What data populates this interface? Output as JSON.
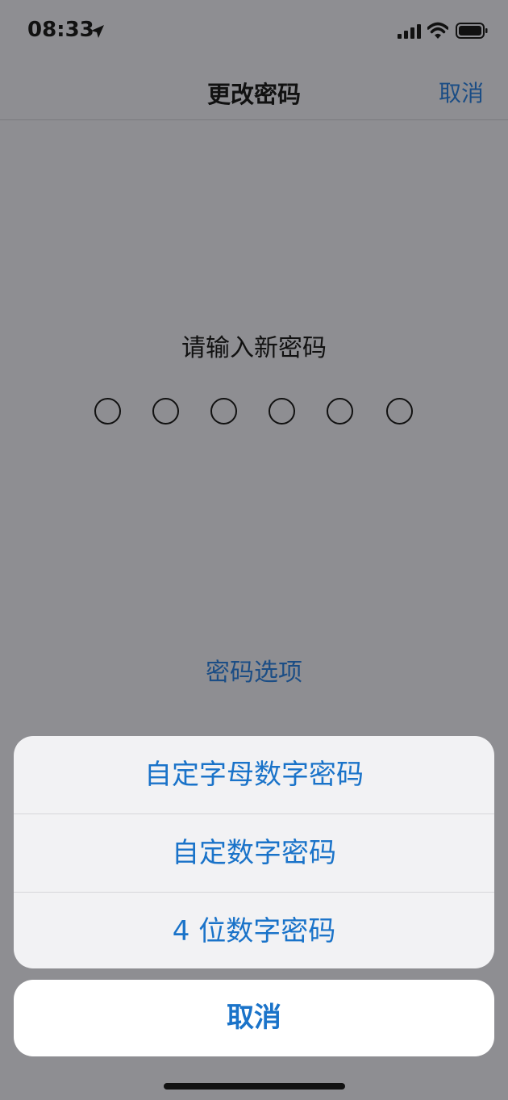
{
  "status": {
    "time": "08:33"
  },
  "nav": {
    "title": "更改密码",
    "cancel": "取消"
  },
  "passcode": {
    "prompt": "请输入新密码",
    "digits": 6,
    "options_link": "密码选项"
  },
  "action_sheet": {
    "items": [
      {
        "label": "自定字母数字密码"
      },
      {
        "label": "自定数字密码"
      },
      {
        "label": "4 位数字密码"
      }
    ],
    "cancel": "取消"
  },
  "colors": {
    "accent": "#1a73c9",
    "dim_background": "#8e8e92"
  }
}
